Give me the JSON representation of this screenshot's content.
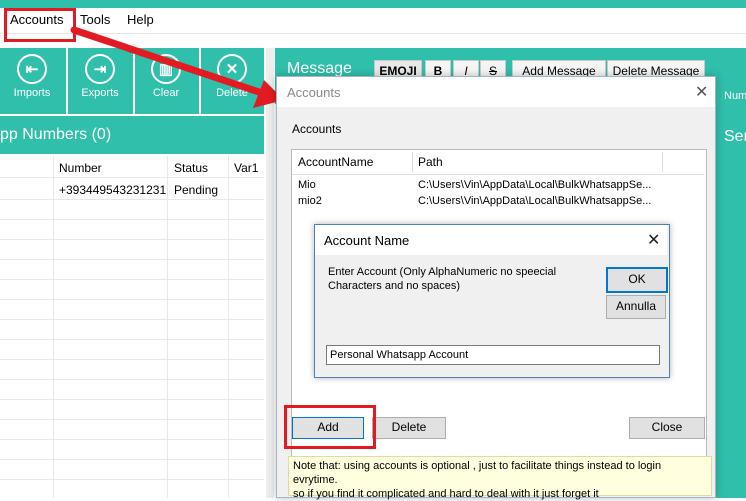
{
  "menu": {
    "accounts": "Accounts",
    "tools": "Tools",
    "help": "Help"
  },
  "toolbar": {
    "imports": "Imports",
    "exports": "Exports",
    "clear": "Clear",
    "delete": "Delete"
  },
  "numbers_panel": {
    "title": "pp Numbers (0)",
    "columns": {
      "number": "Number",
      "status": "Status",
      "var1": "Var1"
    },
    "rows": [
      {
        "number": "+393449543231231",
        "status": "Pending"
      }
    ]
  },
  "message_panel": {
    "label": "Message",
    "emoji": "EMOJI",
    "bold": "B",
    "italic": "I",
    "strike": "S",
    "add_message": "Add Message",
    "delete_message": "Delete Message"
  },
  "right_strip": {
    "num": "Num",
    "ser": "Ser"
  },
  "accounts_dialog": {
    "title": "Accounts",
    "section_label": "Accounts",
    "columns": {
      "name": "AccountName",
      "path": "Path"
    },
    "rows": [
      {
        "name": "Mio",
        "path": "C:\\Users\\Vin\\AppData\\Local\\BulkWhatsappSe..."
      },
      {
        "name": "mio2",
        "path": "C:\\Users\\Vin\\AppData\\Local\\BulkWhatsappSe..."
      }
    ],
    "add": "Add",
    "delete": "Delete",
    "close": "Close",
    "note_line1": "Note that: using accounts is optional , just to facilitate things instead to login evrytime.",
    "note_line2": "so if you find it complicated and hard to deal with it just forget it"
  },
  "name_dialog": {
    "title": "Account Name",
    "prompt": "Enter Account (Only AlphaNumeric no speecial Characters and no spaces)",
    "ok": "OK",
    "cancel": "Annulla",
    "input_value": "Personal Whatsapp Account"
  },
  "colors": {
    "teal": "#2fbfaa",
    "highlight": "#e21b23",
    "arrow": "#e21b23"
  }
}
